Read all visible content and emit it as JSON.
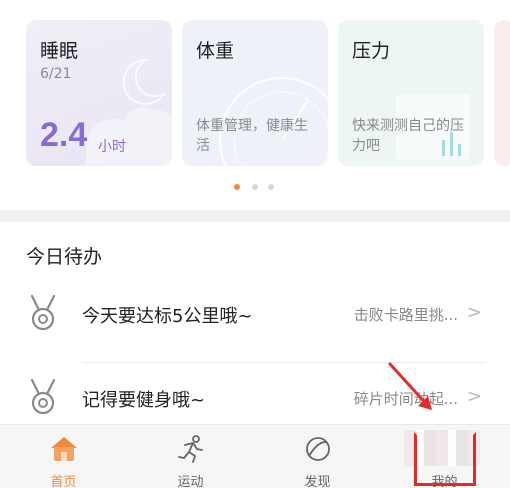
{
  "cards": {
    "sleep": {
      "title": "睡眠",
      "date": "6/21",
      "value": "2.4",
      "unit": "小时"
    },
    "weight": {
      "title": "体重",
      "desc": "体重管理，健康生活"
    },
    "stress": {
      "title": "压力",
      "desc": "快来测测自己的压力吧"
    }
  },
  "carousel": {
    "page_count": 3,
    "active_index": 0
  },
  "todo": {
    "title": "今日待办",
    "items": [
      {
        "icon": "medal-icon",
        "text": "今天要达标5公里哦~",
        "hint": "击败卡路里挑..."
      },
      {
        "icon": "medal-icon",
        "text": "记得要健身哦~",
        "hint": "碎片时间动起..."
      }
    ]
  },
  "tabbar": {
    "items": [
      {
        "icon": "home-icon",
        "label": "首页",
        "active": true
      },
      {
        "icon": "running-icon",
        "label": "运动",
        "active": false
      },
      {
        "icon": "planet-icon",
        "label": "发现",
        "active": false
      },
      {
        "icon": "profile-icon",
        "label": "我的",
        "active": false
      }
    ]
  },
  "colors": {
    "accent": "#f08a3c",
    "sleep_value": "#8b6ad6",
    "highlight": "#e22b2b"
  }
}
